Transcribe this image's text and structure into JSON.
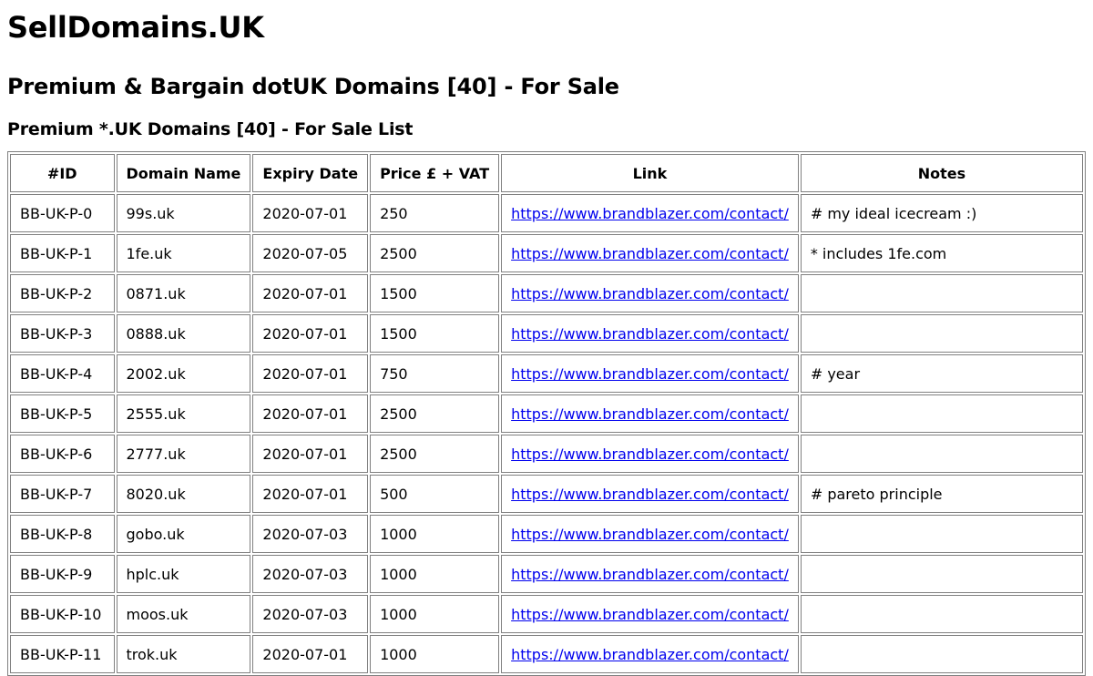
{
  "site_title": "SellDomains.UK",
  "heading": "Premium & Bargain dotUK Domains [40] - For Sale",
  "subheading": "Premium *.UK Domains [40] - For Sale List",
  "table": {
    "headers": [
      "#ID",
      "Domain Name",
      "Expiry Date",
      "Price £ + VAT",
      "Link",
      "Notes"
    ],
    "rows": [
      {
        "id": "BB-UK-P-0",
        "domain": "99s.uk",
        "expiry": "2020-07-01",
        "price": "250",
        "link": "https://www.brandblazer.com/contact/",
        "notes": "# my ideal icecream :)"
      },
      {
        "id": "BB-UK-P-1",
        "domain": "1fe.uk",
        "expiry": "2020-07-05",
        "price": "2500",
        "link": "https://www.brandblazer.com/contact/",
        "notes": "* includes 1fe.com"
      },
      {
        "id": "BB-UK-P-2",
        "domain": "0871.uk",
        "expiry": "2020-07-01",
        "price": "1500",
        "link": "https://www.brandblazer.com/contact/",
        "notes": ""
      },
      {
        "id": "BB-UK-P-3",
        "domain": "0888.uk",
        "expiry": "2020-07-01",
        "price": "1500",
        "link": "https://www.brandblazer.com/contact/",
        "notes": ""
      },
      {
        "id": "BB-UK-P-4",
        "domain": "2002.uk",
        "expiry": "2020-07-01",
        "price": "750",
        "link": "https://www.brandblazer.com/contact/",
        "notes": "# year"
      },
      {
        "id": "BB-UK-P-5",
        "domain": "2555.uk",
        "expiry": "2020-07-01",
        "price": "2500",
        "link": "https://www.brandblazer.com/contact/",
        "notes": ""
      },
      {
        "id": "BB-UK-P-6",
        "domain": "2777.uk",
        "expiry": "2020-07-01",
        "price": "2500",
        "link": "https://www.brandblazer.com/contact/",
        "notes": ""
      },
      {
        "id": "BB-UK-P-7",
        "domain": "8020.uk",
        "expiry": "2020-07-01",
        "price": "500",
        "link": "https://www.brandblazer.com/contact/",
        "notes": "# pareto principle"
      },
      {
        "id": "BB-UK-P-8",
        "domain": "gobo.uk",
        "expiry": "2020-07-03",
        "price": "1000",
        "link": "https://www.brandblazer.com/contact/",
        "notes": ""
      },
      {
        "id": "BB-UK-P-9",
        "domain": "hplc.uk",
        "expiry": "2020-07-03",
        "price": "1000",
        "link": "https://www.brandblazer.com/contact/",
        "notes": ""
      },
      {
        "id": "BB-UK-P-10",
        "domain": "moos.uk",
        "expiry": "2020-07-03",
        "price": "1000",
        "link": "https://www.brandblazer.com/contact/",
        "notes": ""
      },
      {
        "id": "BB-UK-P-11",
        "domain": "trok.uk",
        "expiry": "2020-07-01",
        "price": "1000",
        "link": "https://www.brandblazer.com/contact/",
        "notes": ""
      }
    ]
  },
  "colors": {
    "link": "#0000ee",
    "border": "#808080"
  }
}
